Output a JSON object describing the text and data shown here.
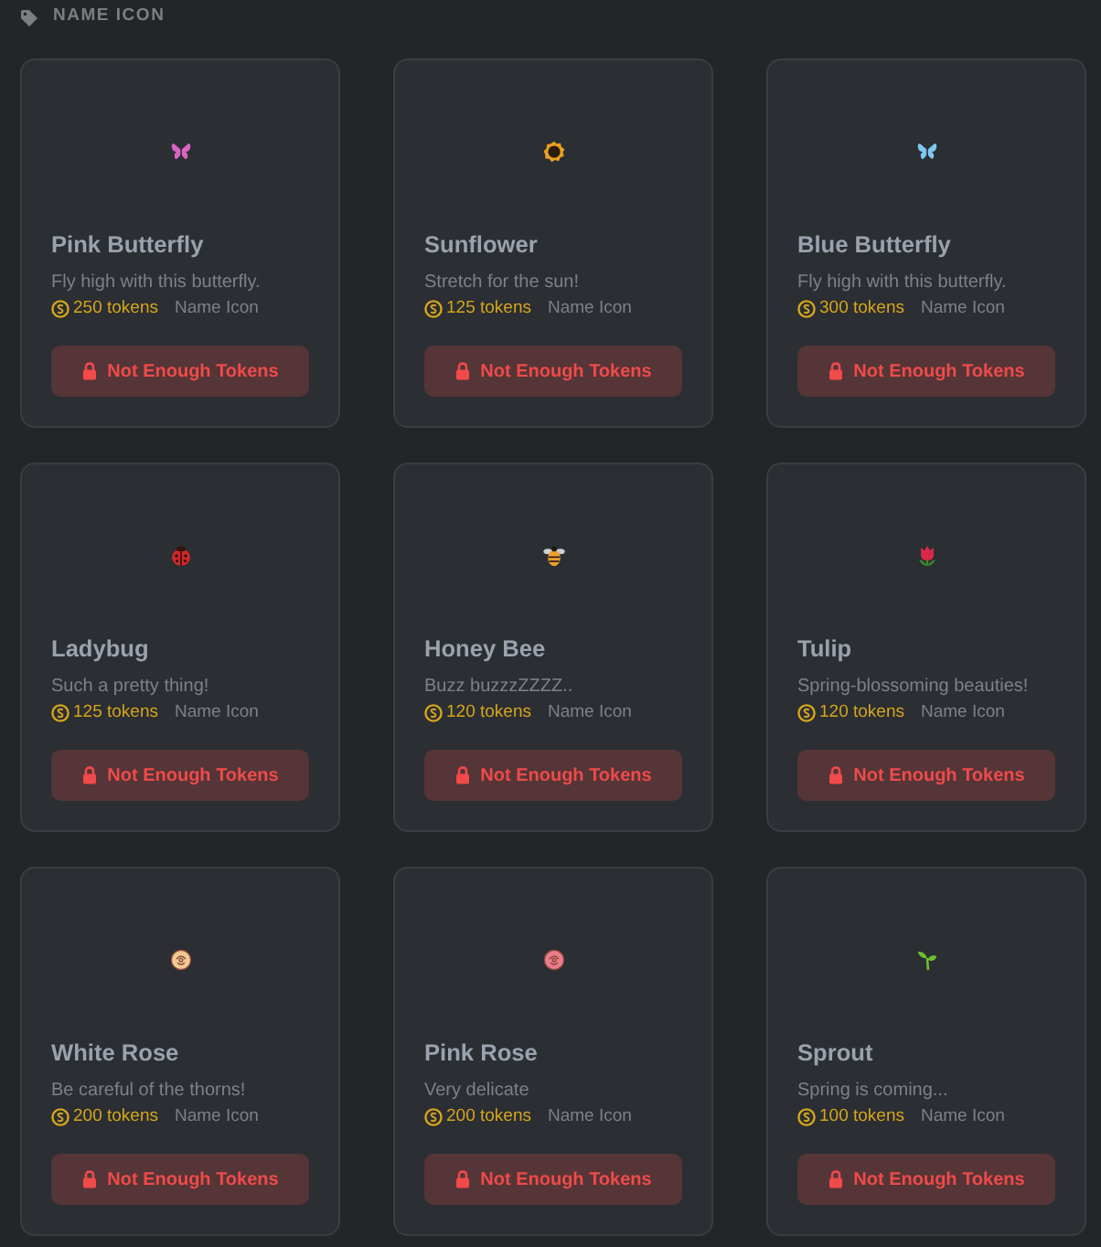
{
  "header": {
    "title": "NAME ICON"
  },
  "items": [
    {
      "name": "Pink Butterfly",
      "description": "Fly high with this butterfly.",
      "price": "250 tokens",
      "category": "Name Icon",
      "icon": {
        "kind": "butterfly",
        "color": "#d864c4"
      },
      "button": {
        "label": "Not Enough Tokens",
        "disabled": true
      }
    },
    {
      "name": "Sunflower",
      "description": "Stretch for the sun!",
      "price": "125 tokens",
      "category": "Name Icon",
      "icon": {
        "kind": "sunflower",
        "color": "#e8a020"
      },
      "button": {
        "label": "Not Enough Tokens",
        "disabled": true
      }
    },
    {
      "name": "Blue Butterfly",
      "description": "Fly high with this butterfly.",
      "price": "300 tokens",
      "category": "Name Icon",
      "icon": {
        "kind": "butterfly",
        "color": "#7cc8f0"
      },
      "button": {
        "label": "Not Enough Tokens",
        "disabled": true
      }
    },
    {
      "name": "Ladybug",
      "description": "Such a pretty thing!",
      "price": "125 tokens",
      "category": "Name Icon",
      "icon": {
        "kind": "ladybug",
        "color": "#d02828"
      },
      "button": {
        "label": "Not Enough Tokens",
        "disabled": true
      }
    },
    {
      "name": "Honey Bee",
      "description": "Buzz buzzzZZZZ..",
      "price": "120 tokens",
      "category": "Name Icon",
      "icon": {
        "kind": "bee",
        "color": "#f0a030"
      },
      "button": {
        "label": "Not Enough Tokens",
        "disabled": true
      }
    },
    {
      "name": "Tulip",
      "description": "Spring-blossoming beauties!",
      "price": "120 tokens",
      "category": "Name Icon",
      "icon": {
        "kind": "tulip",
        "color": "#d8284a"
      },
      "button": {
        "label": "Not Enough Tokens",
        "disabled": true
      }
    },
    {
      "name": "White Rose",
      "description": "Be careful of the thorns!",
      "price": "200 tokens",
      "category": "Name Icon",
      "icon": {
        "kind": "rose",
        "color": "#f4c890"
      },
      "button": {
        "label": "Not Enough Tokens",
        "disabled": true
      }
    },
    {
      "name": "Pink Rose",
      "description": "Very delicate",
      "price": "200 tokens",
      "category": "Name Icon",
      "icon": {
        "kind": "rose",
        "color": "#ec7c8c"
      },
      "button": {
        "label": "Not Enough Tokens",
        "disabled": true
      }
    },
    {
      "name": "Sprout",
      "description": "Spring is coming...",
      "price": "100 tokens",
      "category": "Name Icon",
      "icon": {
        "kind": "sprout",
        "color": "#6cc030"
      },
      "button": {
        "label": "Not Enough Tokens",
        "disabled": true
      }
    }
  ]
}
